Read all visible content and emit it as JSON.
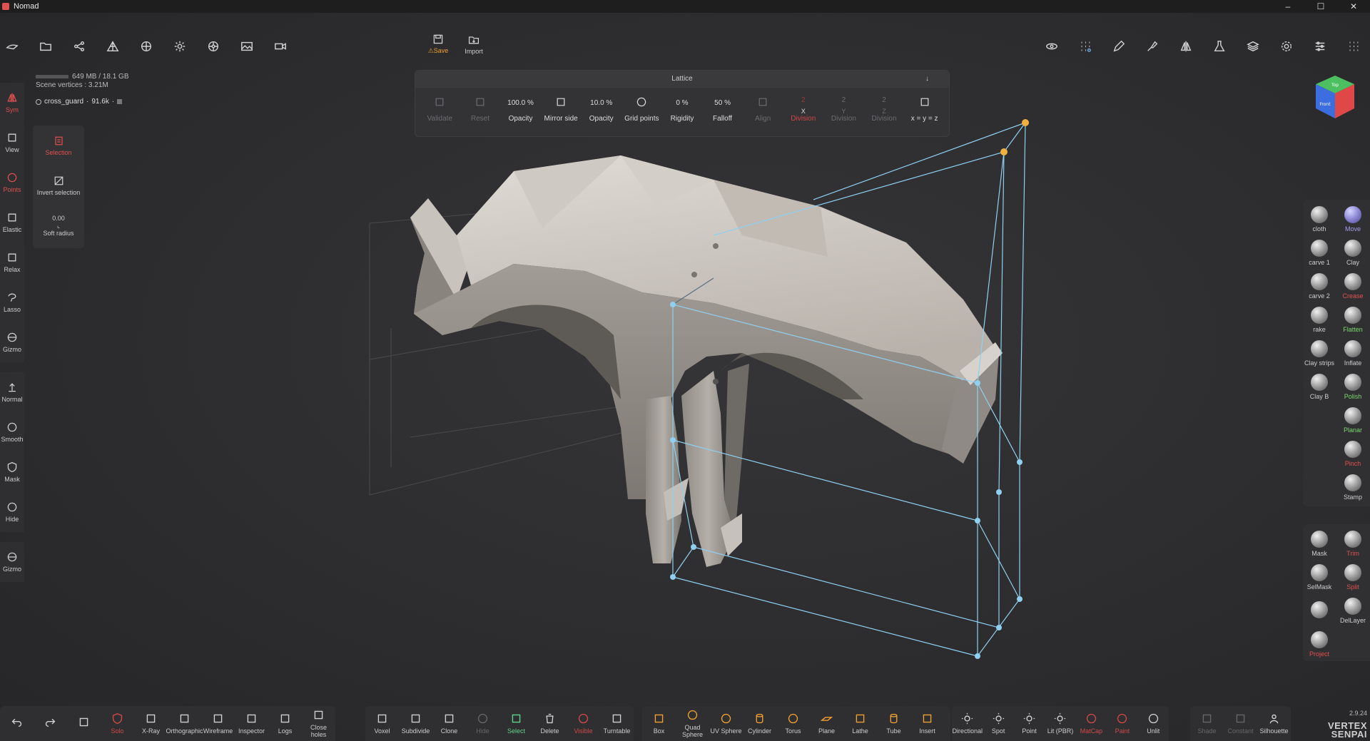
{
  "window": {
    "title": "Nomad",
    "controls": [
      "–",
      "☐",
      "✕"
    ]
  },
  "top_left_toolbar": {
    "icons": [
      "brush-stroke-icon",
      "folder-icon",
      "scene-graph-icon",
      "topology-icon",
      "material-sphere-icon",
      "light-sun-icon",
      "postprocess-icon",
      "background-image-icon",
      "camera-icon"
    ]
  },
  "save_group": {
    "save_label": "Save",
    "import_label": "Import"
  },
  "top_right_toolbar": {
    "icons": [
      "history-icon",
      "grid-dots-icon",
      "pen-icon",
      "brush-icon",
      "symmetry-icon",
      "flask-icon",
      "layers-icon",
      "settings-gear-icon",
      "sliders-icon",
      "menu-grid-icon"
    ]
  },
  "memory": {
    "usage": "649 MB / 18.1 GB",
    "vertices": "Scene vertices : 3.21M"
  },
  "mesh": {
    "name": "cross_guard",
    "verts": "91.6k"
  },
  "lattice": {
    "title": "Lattice",
    "items": [
      {
        "value": "",
        "label": "Validate",
        "state": "dim"
      },
      {
        "value": "",
        "label": "Reset",
        "state": "dim"
      },
      {
        "value": "100.0 %",
        "label": "Opacity",
        "state": "normal"
      },
      {
        "value": "",
        "label": "Mirror side",
        "state": "normal"
      },
      {
        "value": "10.0 %",
        "label": "Opacity",
        "state": "normal"
      },
      {
        "value": "",
        "label": "Grid points",
        "state": "normal"
      },
      {
        "value": "0 %",
        "label": "Rigidity",
        "state": "normal"
      },
      {
        "value": "50 %",
        "label": "Falloff",
        "state": "normal"
      },
      {
        "value": "",
        "label": "Align",
        "state": "dim"
      },
      {
        "value": "2",
        "label": "Division",
        "sub": "X",
        "state": "red"
      },
      {
        "value": "2",
        "label": "Division",
        "sub": "Y",
        "state": "dim"
      },
      {
        "value": "2",
        "label": "Division",
        "sub": "Z",
        "state": "dim"
      },
      {
        "value": "",
        "label": "x = y = z",
        "state": "normal"
      }
    ]
  },
  "left_toolbar": {
    "items": [
      {
        "label": "Sym",
        "icon": "symmetry-icon",
        "active": true
      },
      {
        "label": "View",
        "icon": "camera-icon",
        "active": false
      },
      {
        "label": "Points",
        "icon": "lattice-points-icon",
        "active": true
      },
      {
        "label": "Elastic",
        "icon": "elastic-icon",
        "active": false
      },
      {
        "label": "Relax",
        "icon": "relax-icon",
        "active": false
      },
      {
        "label": "Lasso",
        "icon": "lasso-icon",
        "active": false
      },
      {
        "label": "Gizmo",
        "icon": "gizmo-icon",
        "active": false
      },
      {
        "label": "Normal",
        "icon": "normal-arrow-icon",
        "active": false
      },
      {
        "label": "Smooth",
        "icon": "smooth-sphere-icon",
        "active": false
      },
      {
        "label": "Mask",
        "icon": "mask-shield-icon",
        "active": false
      },
      {
        "label": "Hide",
        "icon": "hide-eye-icon",
        "active": false
      },
      {
        "label": "Gizmo",
        "icon": "gizmo-icon",
        "active": false
      }
    ]
  },
  "sub_panel": {
    "selection_label": "Selection",
    "invert_label": "Invert selection",
    "soft_radius_value": "0.00",
    "soft_radius_label": "Soft radius"
  },
  "brushes": {
    "left": [
      "cloth",
      "carve 1",
      "carve 2",
      "rake",
      "Clay strips",
      "Clay B"
    ],
    "right": [
      "Move",
      "Clay",
      "Crease",
      "Flatten",
      "Inflate",
      "Polish",
      "Planar",
      "Pinch",
      "Stamp"
    ]
  },
  "tools": {
    "left": [
      "Mask",
      "SelMask",
      "",
      "Project"
    ],
    "right": [
      "Trim",
      "Split",
      "DelLayer"
    ]
  },
  "view_cube": {
    "top": "Top",
    "front": "Front"
  },
  "bottom_left": [
    {
      "label": "",
      "icon": "undo-icon"
    },
    {
      "label": "",
      "icon": "redo-icon"
    },
    {
      "label": "",
      "icon": "layer-icon"
    },
    {
      "label": "Solo",
      "icon": "solo-icon",
      "state": "red"
    },
    {
      "label": "X-Ray",
      "icon": "xray-icon"
    },
    {
      "label": "Orthographic",
      "icon": "ortho-icon"
    },
    {
      "label": "Wireframe",
      "icon": "wireframe-icon"
    },
    {
      "label": "Inspector",
      "icon": "inspector-icon"
    },
    {
      "label": "Logs",
      "icon": "logs-bug-icon"
    },
    {
      "label": "Close holes",
      "icon": "close-holes-icon"
    }
  ],
  "bottom_mid": [
    {
      "label": "Voxel",
      "icon": "voxel-icon"
    },
    {
      "label": "Subdivide",
      "icon": "subdivide-icon"
    },
    {
      "label": "Clone",
      "icon": "clone-icon"
    },
    {
      "label": "Hide",
      "icon": "hide-icon",
      "state": "dim"
    },
    {
      "label": "Select",
      "icon": "select-icon",
      "state": "green"
    },
    {
      "label": "Delete",
      "icon": "delete-icon"
    },
    {
      "label": "Visible",
      "icon": "visible-eye-icon",
      "state": "red"
    },
    {
      "label": "Turntable",
      "icon": "turntable-icon"
    }
  ],
  "bottom_prims": [
    {
      "label": "Box",
      "icon": "box-icon"
    },
    {
      "label": "Quad Sphere",
      "icon": "quad-sphere-icon"
    },
    {
      "label": "UV Sphere",
      "icon": "uv-sphere-icon"
    },
    {
      "label": "Cylinder",
      "icon": "cylinder-icon"
    },
    {
      "label": "Torus",
      "icon": "torus-icon"
    },
    {
      "label": "Plane",
      "icon": "plane-icon"
    },
    {
      "label": "Lathe",
      "icon": "lathe-icon"
    },
    {
      "label": "Tube",
      "icon": "tube-icon"
    },
    {
      "label": "Insert",
      "icon": "insert-icon"
    }
  ],
  "bottom_lights": [
    {
      "label": "Directional",
      "icon": "directional-light-icon"
    },
    {
      "label": "Spot",
      "icon": "spot-light-icon"
    },
    {
      "label": "Point",
      "icon": "point-light-icon"
    },
    {
      "label": "Lit (PBR)",
      "icon": "lit-pbr-icon"
    },
    {
      "label": "MatCap",
      "icon": "matcap-icon",
      "state": "red"
    },
    {
      "label": "Paint",
      "icon": "paint-icon",
      "state": "red"
    },
    {
      "label": "Unlit",
      "icon": "unlit-icon"
    }
  ],
  "bottom_right": [
    {
      "label": "Shade",
      "icon": "shade-icon",
      "state": "dim"
    },
    {
      "label": "Constant",
      "icon": "constant-icon",
      "state": "dim"
    },
    {
      "label": "Silhouette",
      "icon": "silhouette-icon"
    }
  ],
  "version": "2.9.24",
  "watermark": {
    "line1": "VERTEX",
    "line2": "SENPAI"
  },
  "colors": {
    "accent_red": "#e05050",
    "select_green": "#5ed38a",
    "lattice_blue": "#8fd0f0",
    "lattice_orange": "#f0b040",
    "move_purple": "#a39ee8"
  }
}
